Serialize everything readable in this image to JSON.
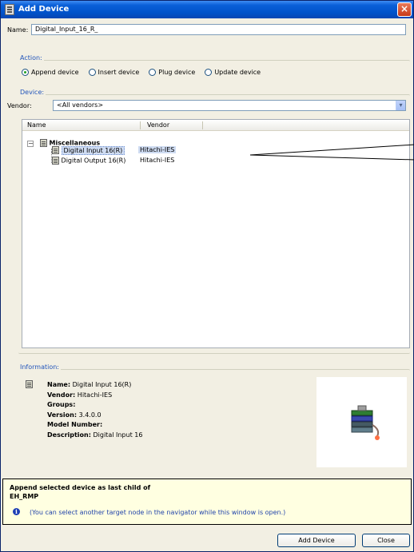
{
  "window": {
    "title": "Add Device",
    "close_glyph": "×"
  },
  "name_row": {
    "label": "Name:",
    "value": "Digital_Input_16_R_"
  },
  "action": {
    "title": "Action:",
    "options": [
      {
        "label": "Append device",
        "selected": true
      },
      {
        "label": "Insert device",
        "selected": false
      },
      {
        "label": "Plug device",
        "selected": false
      },
      {
        "label": "Update device",
        "selected": false
      }
    ]
  },
  "device": {
    "title": "Device:",
    "vendor_label": "Vendor:",
    "vendor_value": "<All vendors>",
    "columns": [
      "Name",
      "Vendor"
    ],
    "tree": {
      "group_toggle": "−",
      "group_name": "Miscellaneous",
      "items": [
        {
          "name": "Digital Input 16(R)",
          "vendor": "Hitachi-IES",
          "selected": true
        },
        {
          "name": "Digital Output 16(R)",
          "vendor": "Hitachi-IES",
          "selected": false
        }
      ]
    }
  },
  "information": {
    "title": "Information:",
    "name_label": "Name:",
    "name_value": "Digital Input 16(R)",
    "vendor_label": "Vendor:",
    "vendor_value": "Hitachi-IES",
    "groups_label": "Groups:",
    "version_label": "Version:",
    "version_value": "3.4.0.0",
    "model_label": "Model Number:",
    "description_label": "Description:",
    "description_value": "Digital Input 16"
  },
  "hint": {
    "line1": "Append selected device as last child of",
    "line2": "EH_RMP",
    "info_glyph": "i",
    "line3": "(You can select another target node in the navigator while this window is open.)"
  },
  "buttons": {
    "add": "Add Device",
    "close": "Close"
  },
  "colors": {
    "title_bar": "#0052c9",
    "group_title": "#2255bb",
    "hint_bg": "#ffffe1",
    "selection": "#cfdcf2"
  },
  "icons": [
    "device-chip-icon",
    "radio-icon",
    "dropdown-arrow-icon",
    "info-icon",
    "close-icon",
    "tree-expand-icon",
    "device-preview-icon"
  ]
}
